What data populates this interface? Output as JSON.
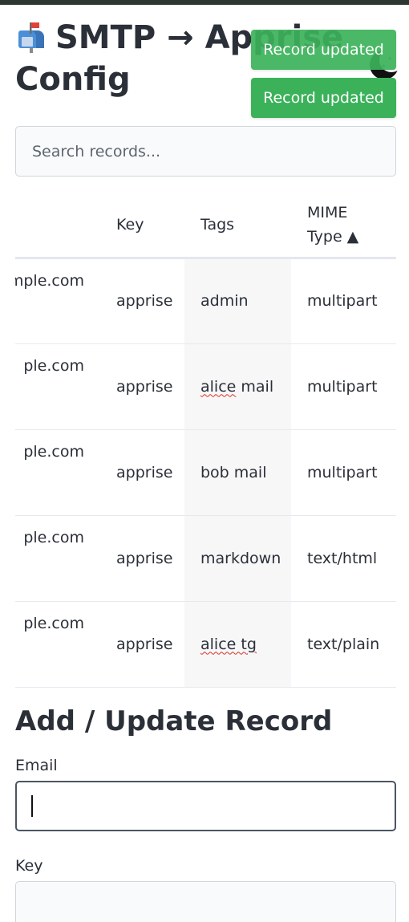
{
  "page": {
    "title_emoji": "📫",
    "title": "SMTP → Apprise Config"
  },
  "toasts": [
    "Record updated",
    "Record updated"
  ],
  "search": {
    "placeholder": "Search records..."
  },
  "table": {
    "columns": [
      {
        "label": ""
      },
      {
        "label": "Key"
      },
      {
        "label": "Tags"
      },
      {
        "label": "MIME Type ▲"
      }
    ],
    "rows": [
      {
        "email": "mple.com",
        "key": "apprise",
        "tags": "admin",
        "mime": "multipart"
      },
      {
        "email": "ple.com",
        "key": "apprise",
        "tags": "alice mail",
        "mime": "multipart"
      },
      {
        "email": "ple.com",
        "key": "apprise",
        "tags": "bob mail",
        "mime": "multipart"
      },
      {
        "email": "ple.com",
        "key": "apprise",
        "tags": "markdown",
        "mime": "text/html"
      },
      {
        "email": "ple.com",
        "key": "apprise",
        "tags": "alice tg",
        "mime": "text/plain"
      }
    ]
  },
  "form": {
    "title": "Add / Update Record",
    "email_label": "Email",
    "email_value": "",
    "key_label": "Key",
    "key_value": ""
  },
  "colors": {
    "toast": "#3bb25a",
    "topbar": "#2e3833",
    "text": "#2b2f38"
  },
  "icons": {
    "title": "mailbox-icon",
    "theme": "moon-icon"
  }
}
